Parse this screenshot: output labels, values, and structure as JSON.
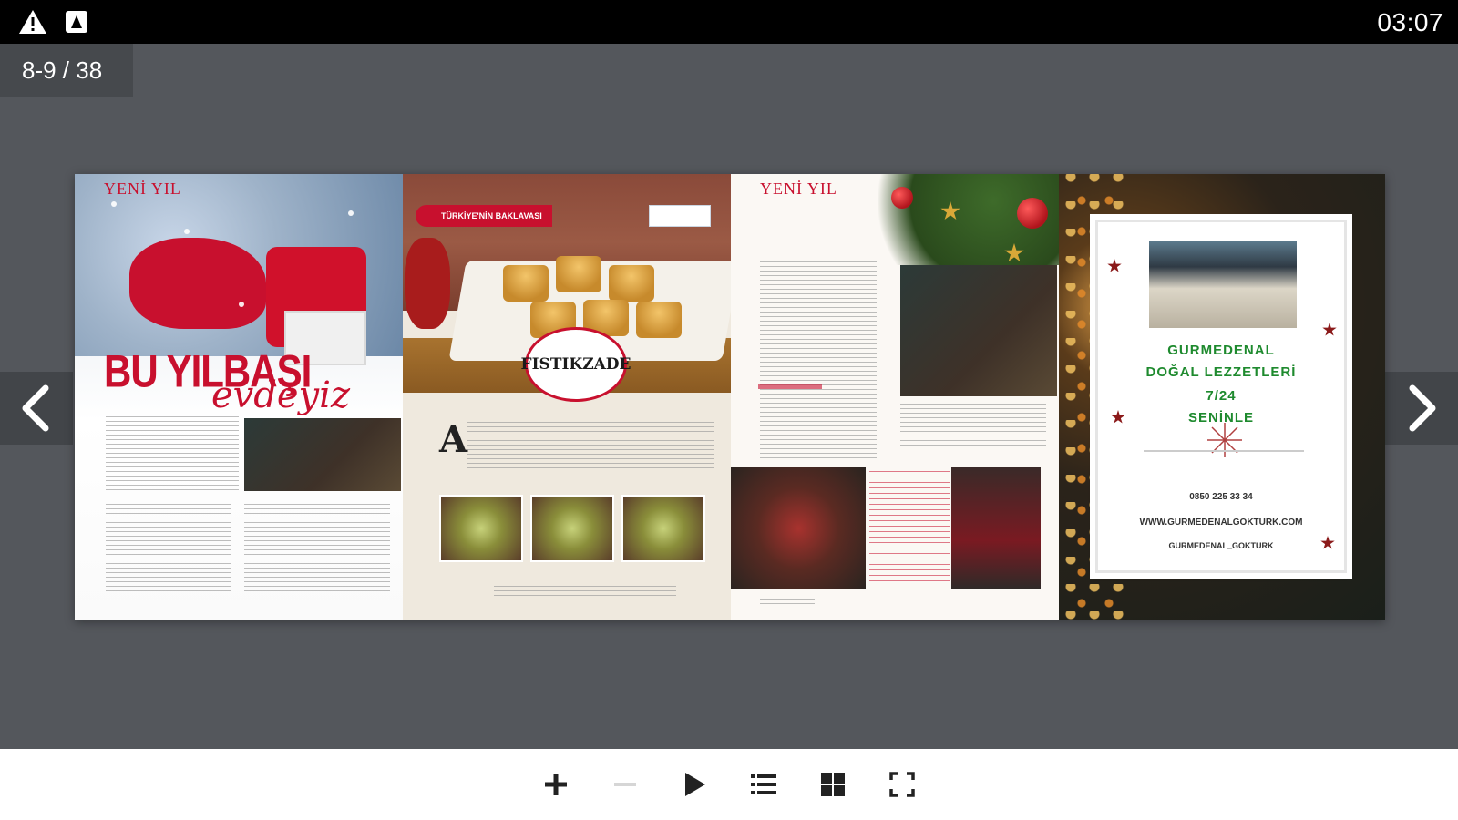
{
  "status_bar": {
    "time": "03:07",
    "icons": [
      "warning-icon",
      "notification-app-icon"
    ]
  },
  "viewer": {
    "page_indicator": "8-9 / 38",
    "prev_icon": "chevron-left-icon",
    "next_icon": "chevron-right-icon"
  },
  "spread": {
    "page_left_a": {
      "kicker": "YENİ YIL",
      "headline": "BU YILBAŞI",
      "script": "evdeyiz"
    },
    "page_left_b": {
      "ribbon": "TÜRKİYE'NİN BAKLAVASI",
      "brand_logo": "FISTIKZADE",
      "dropcap": "A"
    },
    "page_right_a": {
      "kicker": "YENİ YIL"
    },
    "page_right_b": {
      "ad_line1": "GURMEDENAL",
      "ad_line2": "DOĞAL LEZZETLERİ",
      "ad_line3": "7/24",
      "ad_line4": "SENİNLE",
      "ad_phone": "0850 225 33 34",
      "ad_web": "WWW.GURMEDENALGOKTURK.COM",
      "ad_insta": "GURMEDENAL_GOKTURK"
    }
  },
  "toolbar": {
    "icons": [
      "zoom-in-icon",
      "zoom-out-icon",
      "play-icon",
      "table-of-contents-icon",
      "grid-view-icon",
      "fullscreen-icon"
    ]
  },
  "colors": {
    "status_bar_bg": "#000000",
    "viewer_bg": "#54575c",
    "toolbar_bg": "#ffffff",
    "accent_red": "#c8102e",
    "ad_green": "#1e8a2e"
  }
}
